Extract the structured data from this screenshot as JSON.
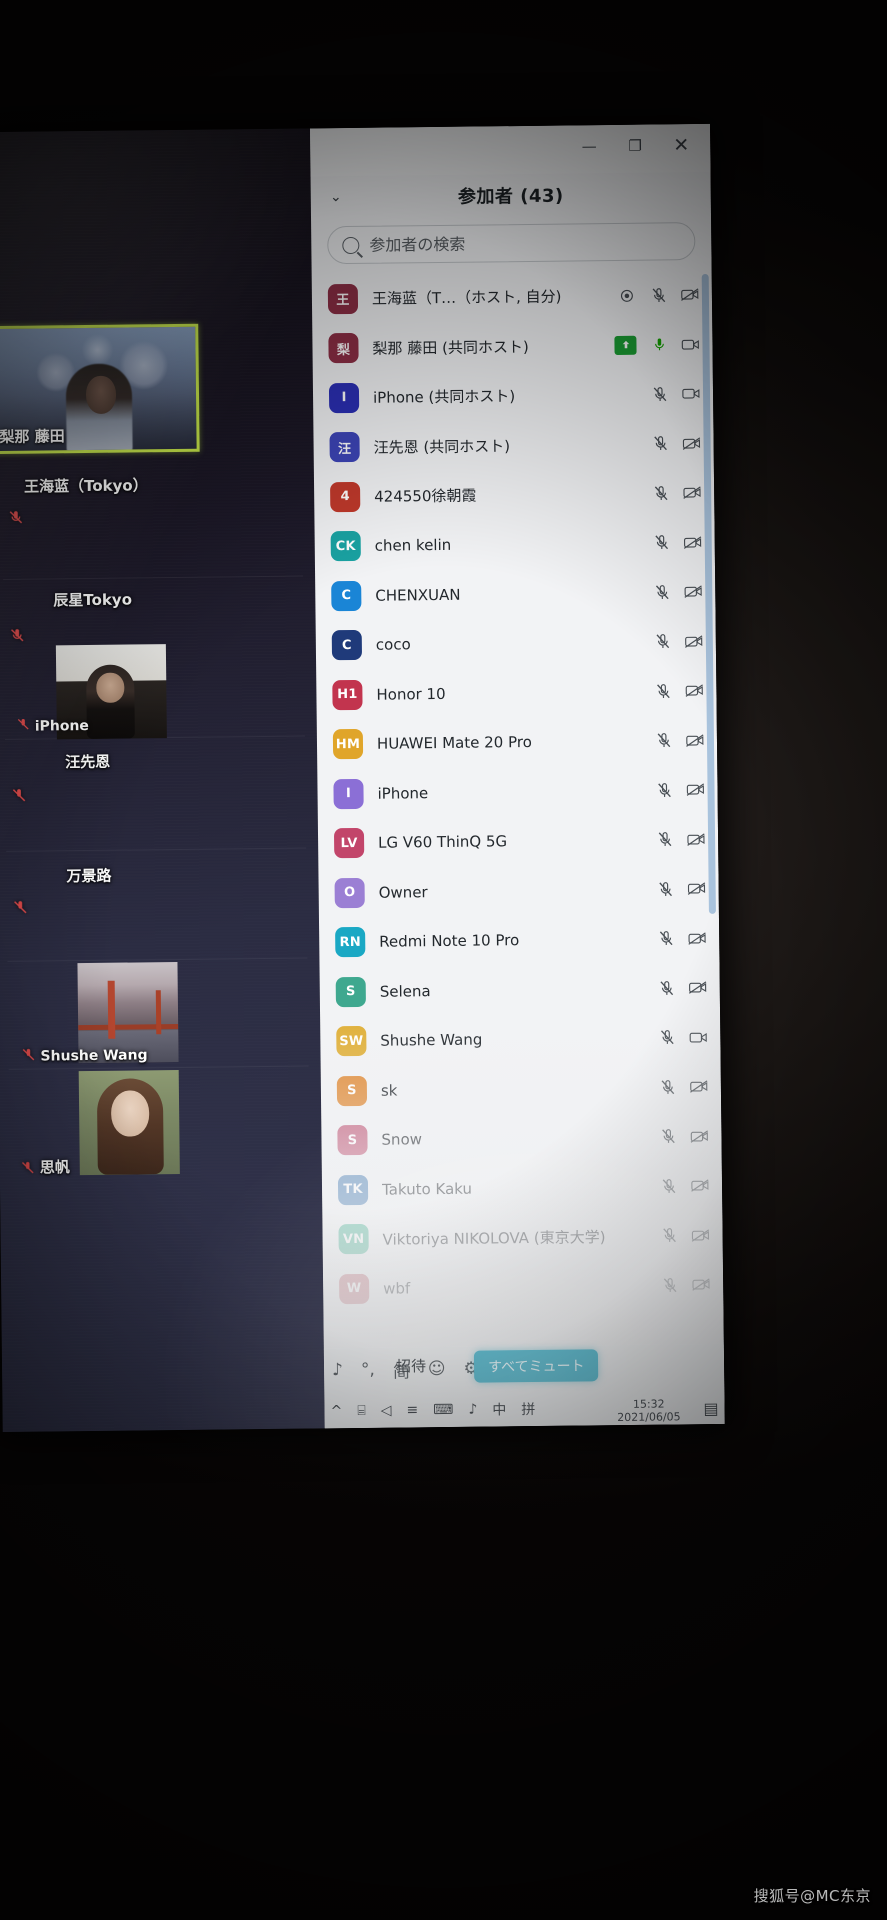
{
  "watermark": "搜狐号@MC东京",
  "window": {
    "minimize": "—",
    "restore": "❐",
    "close": "✕"
  },
  "panel": {
    "collapse_icon": "⌄",
    "title": "参加者 (43)",
    "search": {
      "placeholder": "参加者の検索",
      "value": ""
    }
  },
  "gallery": {
    "active_speaker": {
      "name": "梨那 藤田"
    },
    "tiles": [
      {
        "name": "王海蓝（Tokyo）",
        "muted": true
      },
      {
        "name": "辰星Tokyo",
        "muted": true
      },
      {
        "name": "iPhone",
        "muted": true
      },
      {
        "name": "汪先恩",
        "muted": true
      },
      {
        "name": "万景路",
        "muted": true
      },
      {
        "name": "Shushe Wang",
        "muted": true
      },
      {
        "name": "思帆",
        "muted": true
      }
    ]
  },
  "participants": [
    {
      "initials": "王",
      "avatar_color": "#8e2f46",
      "name": "王海蓝（T…（ホスト, 自分)",
      "mic": "muted",
      "cam": "off",
      "has_record_dot": true
    },
    {
      "initials": "梨",
      "avatar_color": "#8e2f46",
      "name": "梨那 藤田 (共同ホスト)",
      "mic": "unmuted",
      "cam": "on",
      "has_green_badge": true
    },
    {
      "initials": "I",
      "avatar_color": "#2b2fb5",
      "name": "iPhone (共同ホスト)",
      "mic": "muted",
      "cam": "on"
    },
    {
      "initials": "汪",
      "avatar_color": "#3d45b8",
      "name": "汪先恩 (共同ホスト)",
      "mic": "muted",
      "cam": "off"
    },
    {
      "initials": "4",
      "avatar_color": "#c0392b",
      "name": "424550徐朝霞",
      "mic": "muted",
      "cam": "off"
    },
    {
      "initials": "CK",
      "avatar_color": "#1aa3a3",
      "name": "chen kelin",
      "mic": "muted",
      "cam": "off"
    },
    {
      "initials": "C",
      "avatar_color": "#1a85d6",
      "name": "CHENXUAN",
      "mic": "muted",
      "cam": "off"
    },
    {
      "initials": "C",
      "avatar_color": "#1f3a7a",
      "name": "coco",
      "mic": "muted",
      "cam": "off"
    },
    {
      "initials": "H1",
      "avatar_color": "#c2344e",
      "name": "Honor 10",
      "mic": "muted",
      "cam": "off"
    },
    {
      "initials": "HM",
      "avatar_color": "#e0a52a",
      "name": "HUAWEI Mate 20 Pro",
      "mic": "muted",
      "cam": "off"
    },
    {
      "initials": "I",
      "avatar_color": "#8b6fd6",
      "name": "iPhone",
      "mic": "muted",
      "cam": "off"
    },
    {
      "initials": "LV",
      "avatar_color": "#c2456a",
      "name": "LG V60 ThinQ 5G",
      "mic": "muted",
      "cam": "off"
    },
    {
      "initials": "O",
      "avatar_color": "#9b7fd4",
      "name": "Owner",
      "mic": "muted",
      "cam": "off"
    },
    {
      "initials": "RN",
      "avatar_color": "#1aa8c4",
      "name": "Redmi Note 10 Pro",
      "mic": "muted",
      "cam": "off"
    },
    {
      "initials": "S",
      "avatar_color": "#3fa88f",
      "name": "Selena",
      "mic": "muted",
      "cam": "off"
    },
    {
      "initials": "SW",
      "avatar_color": "#e0b03a",
      "name": "Shushe Wang",
      "mic": "muted",
      "cam": "on"
    },
    {
      "initials": "S",
      "avatar_color": "#e08a35",
      "name": "sk",
      "mic": "muted",
      "cam": "off"
    },
    {
      "initials": "S",
      "avatar_color": "#c4617e",
      "name": "Snow",
      "mic": "muted",
      "cam": "off"
    },
    {
      "initials": "TK",
      "avatar_color": "#4a7fb5",
      "name": "Takuto Kaku",
      "mic": "muted",
      "cam": "off"
    },
    {
      "initials": "VN",
      "avatar_color": "#4fb89a",
      "name": "Viktoriya NIKOLOVA (東京大学)",
      "mic": "muted",
      "cam": "off"
    },
    {
      "initials": "W",
      "avatar_color": "#c4707a",
      "name": "wbf",
      "mic": "muted",
      "cam": "off"
    }
  ],
  "footer": {
    "ime": [
      "♪",
      "°,",
      "简",
      "☺",
      "⚙"
    ],
    "invite_label": "招待",
    "mute_all_label": "すべてミュート"
  },
  "taskbar": {
    "icons": [
      "^",
      "⌸",
      "◁",
      "≡",
      "⌨",
      "♪",
      "中",
      "拼"
    ],
    "time": "15:32",
    "date": "2021/06/05",
    "notification_icon": "▤"
  }
}
